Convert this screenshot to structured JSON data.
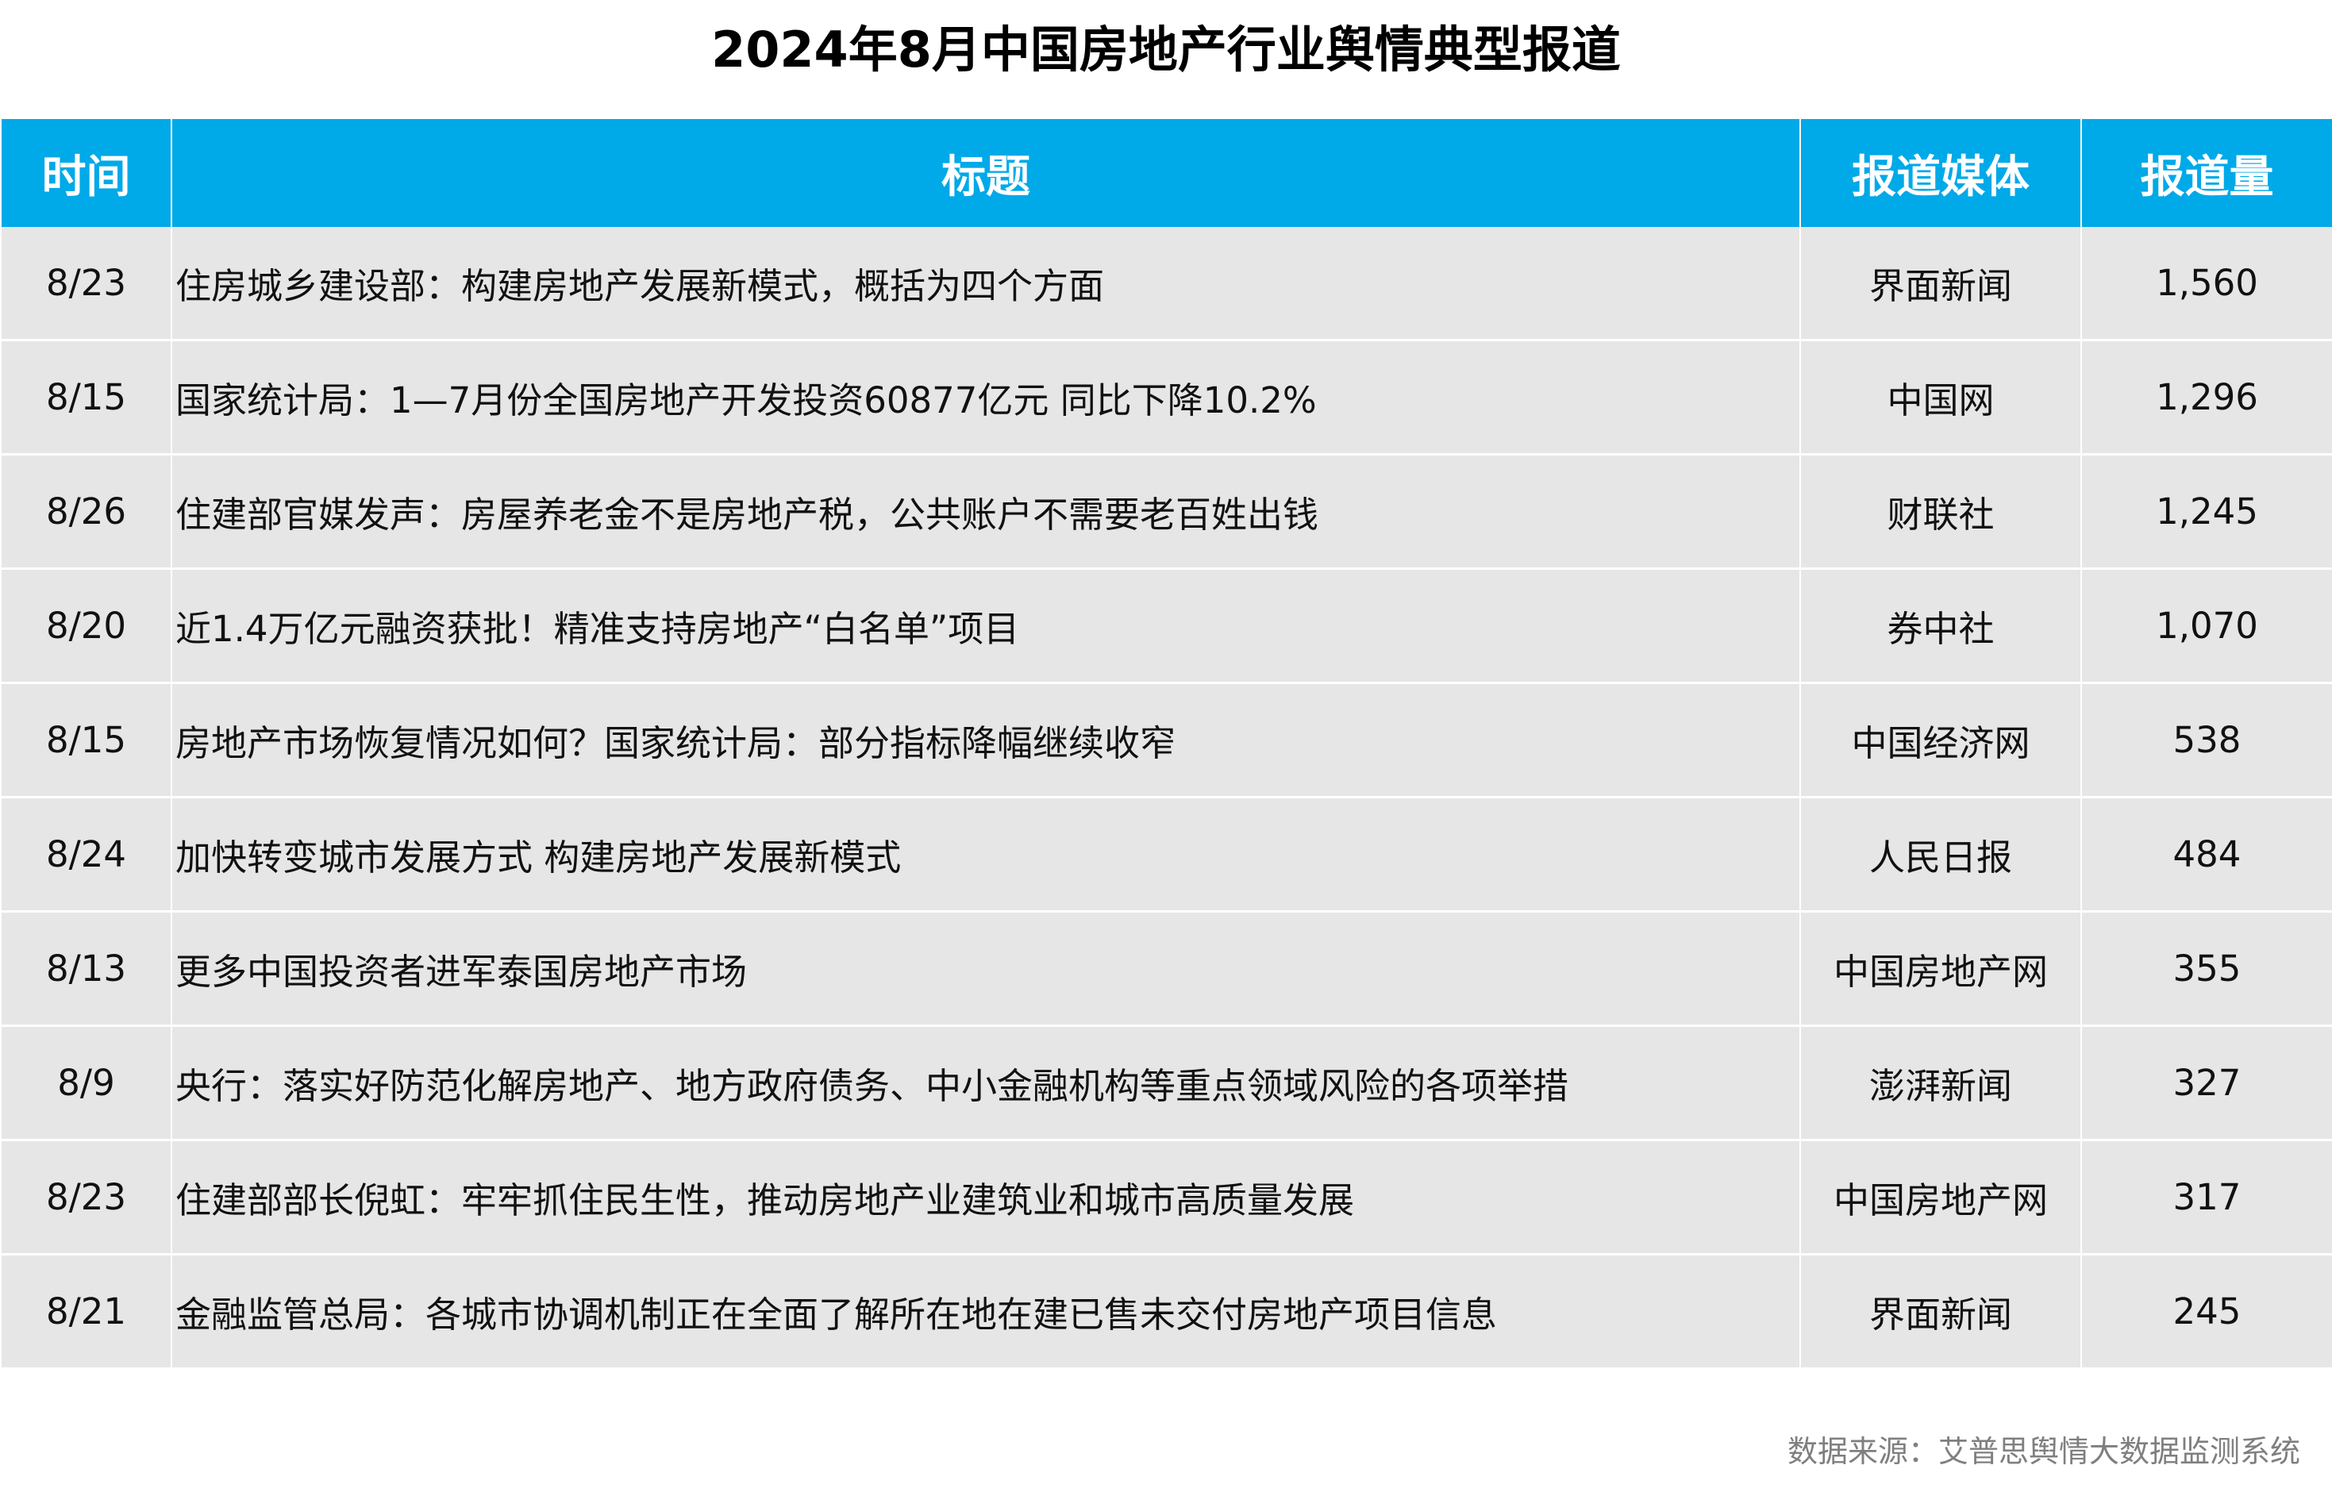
{
  "title": "2024年8月中国房地产行业舆情典型报道",
  "colors": {
    "header_bg": "#00a9e8",
    "header_text": "#ffffff",
    "row_bg": "#e6e6e6",
    "source_text": "#7f7f7f"
  },
  "chart_data": {
    "type": "table",
    "columns": [
      "时间",
      "标题",
      "报道媒体",
      "报道量"
    ],
    "rows": [
      {
        "date": "8/23",
        "title": "住房城乡建设部：构建房地产发展新模式，概括为四个方面",
        "media": "界面新闻",
        "count": "1,560"
      },
      {
        "date": "8/15",
        "title": "国家统计局：1—7月份全国房地产开发投资60877亿元 同比下降10.2%",
        "media": "中国网",
        "count": "1,296"
      },
      {
        "date": "8/26",
        "title": "住建部官媒发声：房屋养老金不是房地产税，公共账户不需要老百姓出钱",
        "media": "财联社",
        "count": "1,245"
      },
      {
        "date": "8/20",
        "title": "近1.4万亿元融资获批！精准支持房地产“白名单”项目",
        "media": "券中社",
        "count": "1,070"
      },
      {
        "date": "8/15",
        "title": "房地产市场恢复情况如何？国家统计局：部分指标降幅继续收窄",
        "media": "中国经济网",
        "count": "538"
      },
      {
        "date": "8/24",
        "title": "加快转变城市发展方式 构建房地产发展新模式",
        "media": "人民日报",
        "count": "484"
      },
      {
        "date": "8/13",
        "title": "更多中国投资者进军泰国房地产市场",
        "media": "中国房地产网",
        "count": "355"
      },
      {
        "date": "8/9",
        "title": "央行：落实好防范化解房地产、地方政府债务、中小金融机构等重点领域风险的各项举措",
        "media": "澎湃新闻",
        "count": "327"
      },
      {
        "date": "8/23",
        "title": "住建部部长倪虹：牢牢抓住民生性，推动房地产业建筑业和城市高质量发展",
        "media": "中国房地产网",
        "count": "317"
      },
      {
        "date": "8/21",
        "title": "金融监管总局：各城市协调机制正在全面了解所在地在建已售未交付房地产项目信息",
        "media": "界面新闻",
        "count": "245"
      }
    ]
  },
  "source": "数据来源：艾普思舆情大数据监测系统"
}
